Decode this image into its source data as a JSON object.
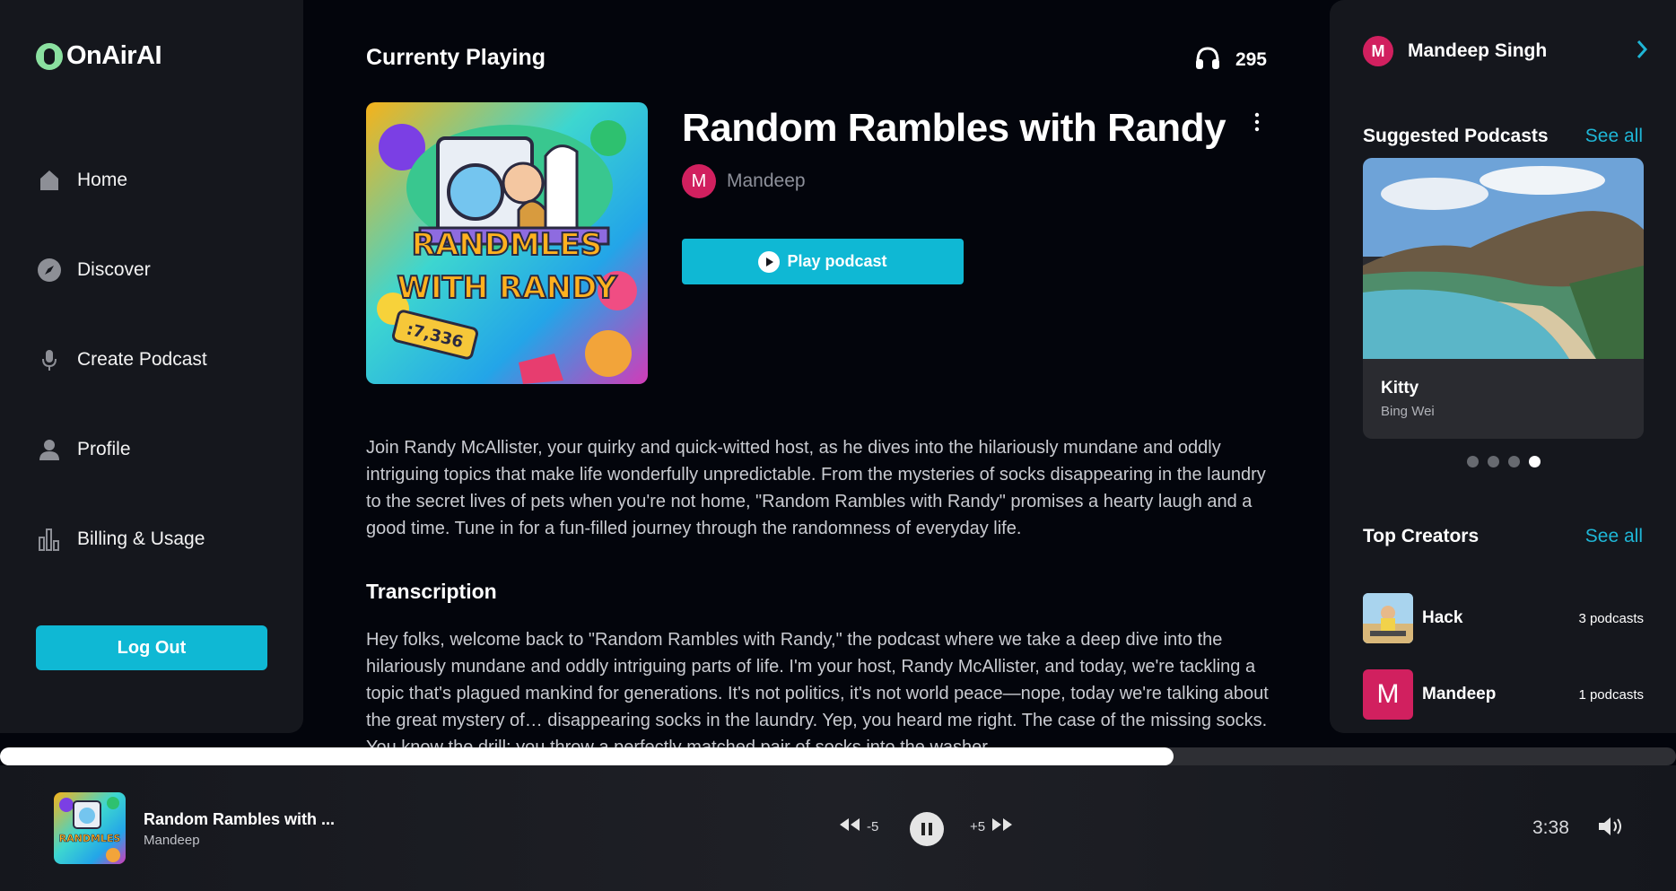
{
  "app": {
    "name": "OnAirAI"
  },
  "sidebar": {
    "items": [
      {
        "label": "Home",
        "icon": "home-icon"
      },
      {
        "label": "Discover",
        "icon": "compass-icon"
      },
      {
        "label": "Create Podcast",
        "icon": "microphone-icon"
      },
      {
        "label": "Profile",
        "icon": "user-icon"
      },
      {
        "label": "Billing & Usage",
        "icon": "bar-chart-icon"
      }
    ],
    "logout_label": "Log Out"
  },
  "main": {
    "section_title": "Currenty Playing",
    "listen_count": "295",
    "podcast_title": "Random Rambles with Randy",
    "author_initial": "M",
    "author_name": "Mandeep",
    "play_label": "Play podcast",
    "cover_text_line1": "RANDMLES",
    "cover_text_line2": "WITH RANDY",
    "cover_tag": ":7,336",
    "description": "Join Randy McAllister, your quirky and quick-witted host, as he dives into the hilariously mundane and oddly intriguing topics that make life wonderfully unpredictable. From the mysteries of socks disappearing in the laundry to the secret lives of pets when you're not home, \"Random Rambles with Randy\" promises a hearty laugh and a good time. Tune in for a fun-filled journey through the randomness of everyday life.",
    "transcription_title": "Transcription",
    "transcription": "Hey folks, welcome back to \"Random Rambles with Randy,\" the podcast where we take a deep dive into the hilariously mundane and oddly intriguing parts of life. I'm your host, Randy McAllister, and today, we're tackling a topic that's plagued mankind for generations. It's not politics, it's not world peace—nope, today we're talking about the great mystery of… disappearing socks in the laundry. Yep, you heard me right. The case of the missing socks. You know the drill: you throw a perfectly matched pair of socks into the washer"
  },
  "rightbar": {
    "user_initial": "M",
    "user_name": "Mandeep Singh",
    "suggested_heading": "Suggested Podcasts",
    "see_all_label": "See all",
    "suggested_card": {
      "title": "Kitty",
      "author": "Bing Wei"
    },
    "carousel_active_index": 3,
    "creators_heading": "Top Creators",
    "creators": [
      {
        "name": "Hack",
        "count": "3 podcasts"
      },
      {
        "initial": "M",
        "name": "Mandeep",
        "count": "1 podcasts"
      }
    ]
  },
  "player": {
    "title": "Random Rambles with ...",
    "author": "Mandeep",
    "rewind_label": "-5",
    "forward_label": "+5",
    "time": "3:38",
    "progress": 0.7,
    "cover_text": "RANDMLES"
  },
  "colors": {
    "accent": "#0fb8d4",
    "link": "#1fb6d6",
    "avatar": "#d1205f",
    "panel": "#15171d",
    "background": "#03050c"
  }
}
